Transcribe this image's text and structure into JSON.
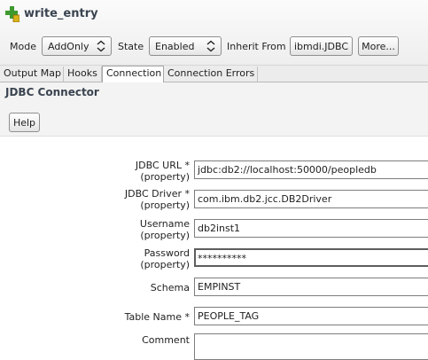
{
  "title": "write_entry",
  "toolbar": {
    "mode_label": "Mode",
    "mode_value": "AddOnly",
    "state_label": "State",
    "state_value": "Enabled",
    "inherit_label": "Inherit From",
    "inherit_value": "ibmdi.JDBC",
    "more_label": "More..."
  },
  "tabs": [
    {
      "label": "Output Map"
    },
    {
      "label": "Hooks"
    },
    {
      "label": "Connection"
    },
    {
      "label": "Connection Errors"
    }
  ],
  "active_tab": "Connection",
  "section": {
    "title": "JDBC Connector",
    "help_label": "Help"
  },
  "fields": {
    "jdbc_url": {
      "label_1": "JDBC URL *",
      "label_2": "(property)",
      "value": "jdbc:db2://localhost:50000/peopledb"
    },
    "jdbc_driver": {
      "label_1": "JDBC Driver *",
      "label_2": "(property)",
      "value": "com.ibm.db2.jcc.DB2Driver"
    },
    "username": {
      "label_1": "Username",
      "label_2": "(property)",
      "value": "db2inst1"
    },
    "password": {
      "label_1": "Password",
      "label_2": "(property)",
      "value": "**********"
    },
    "schema": {
      "label": "Schema",
      "value": "EMPINST"
    },
    "table_name": {
      "label": "Table Name *",
      "value": "PEOPLE_TAG"
    },
    "comment": {
      "label": "Comment",
      "value": ""
    }
  },
  "colors": {
    "title_text": "#3a4450",
    "icon_green": "#3e9a2e",
    "icon_yellow": "#d8b21a"
  }
}
